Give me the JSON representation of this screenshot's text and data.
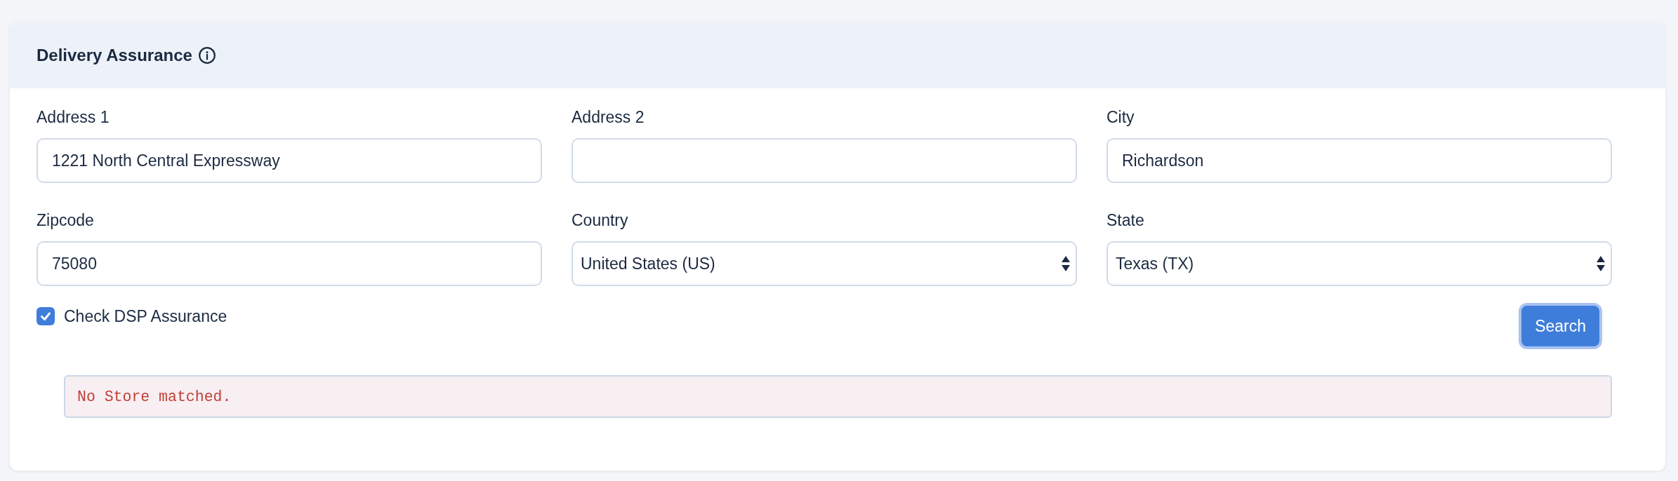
{
  "card": {
    "title": "Delivery Assurance"
  },
  "fields": [
    {
      "kind": "text",
      "label": "Address 1",
      "value": "1221 North Central Expressway"
    },
    {
      "kind": "text",
      "label": "Address 2"
    },
    {
      "kind": "text",
      "label": "City",
      "value": "Richardson"
    },
    {
      "kind": "text",
      "label": "Zipcode",
      "value": "75080"
    },
    {
      "kind": "select",
      "label": "Country",
      "value": "United States (US)"
    },
    {
      "kind": "select",
      "label": "State",
      "value": "Texas (TX)"
    }
  ],
  "dsp_check": {
    "label": "Check DSP Assurance",
    "checked": true
  },
  "search_button": {
    "label": "Search",
    "focused": true
  },
  "message": {
    "text": "No Store matched."
  }
}
